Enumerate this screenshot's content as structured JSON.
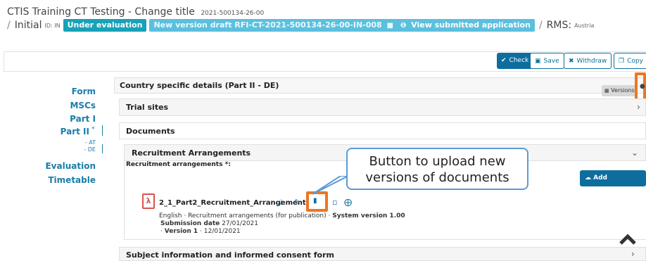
{
  "header": {
    "title": "CTIS Training CT Testing - Change title",
    "title_id": "2021-500134-26-00",
    "crumb_label": "Initial",
    "crumb_id": "ID: IN",
    "status_badge": "Under evaluation",
    "draft_badge": "New version draft RFI-CT-2021-500134-26-00-IN-008",
    "view_submitted": "View submitted application",
    "rms_label": "RMS:",
    "rms_value": "Austria"
  },
  "toolbar": {
    "check": "Check",
    "save": "Save",
    "withdraw": "Withdraw",
    "copy": "Copy"
  },
  "nav": {
    "items": [
      "Form",
      "MSCs",
      "Part I",
      "Part II",
      "- AT",
      "- DE",
      "Evaluation",
      "Timetable"
    ],
    "required_marker": "*"
  },
  "main": {
    "country_title": "Country specific details (Part II - DE)",
    "versions_label": "Versions",
    "trial_sites": "Trial sites",
    "documents": "Documents",
    "recruitment_title": "Recruitment Arrangements",
    "recruitment_field": "Recruitment arrangements *:",
    "add_document": "Add document",
    "doc_name": "2_1_Part2_Recruitment_Arrangement",
    "doc_meta_line1": "English · Recruitment arrangements (for publication) · ",
    "doc_system_version": "System version 1.00",
    "doc_submission_label": "Submission date",
    "doc_submission_date": "27/01/2021",
    "doc_version_label": "Version 1",
    "doc_version_date": " · 12/01/2021",
    "subject_info": "Subject information and informed consent form"
  },
  "callout": {
    "line1": "Button to upload new",
    "line2": "versions of documents"
  },
  "colors": {
    "accent": "#0d6e9e",
    "highlight": "#ee7623",
    "callout_border": "#5b9bd5",
    "badge_eval": "#17a2b8",
    "badge_draft": "#5bc0de"
  }
}
